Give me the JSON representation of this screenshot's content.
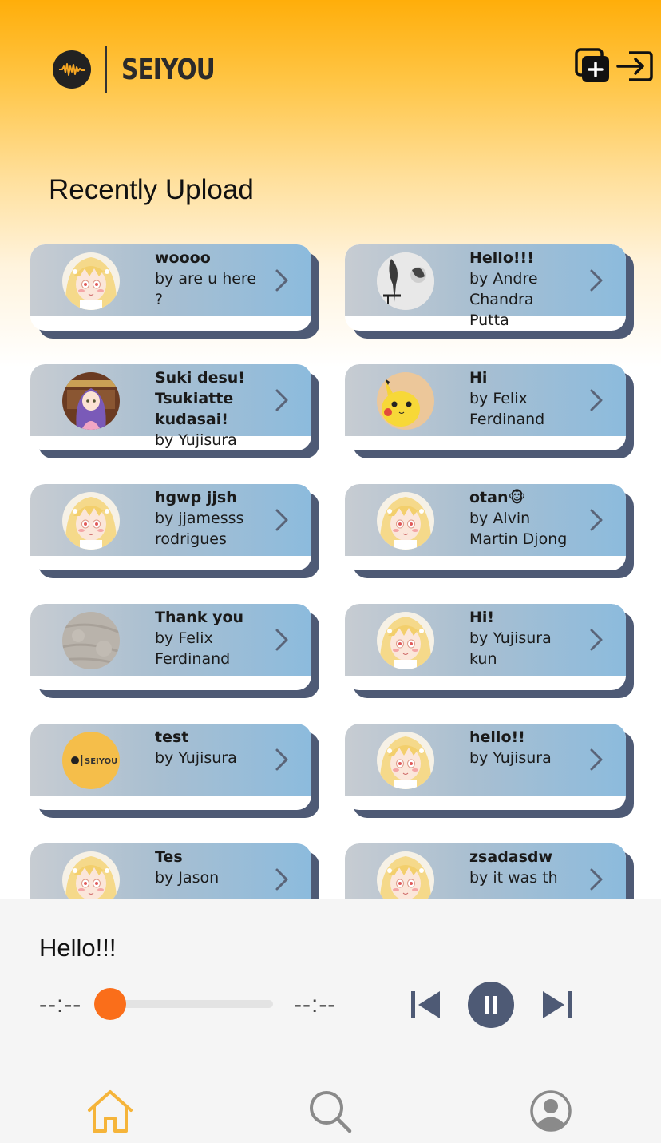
{
  "header": {
    "logo_text": "SEIYOU",
    "add_playlist_icon": "add-to-library-icon",
    "upload_icon": "import-arrow-icon"
  },
  "section": {
    "title": "Recently Upload"
  },
  "cards": [
    {
      "title": "woooo",
      "byline": "by are u here ?",
      "avatar": "anime-girl"
    },
    {
      "title": "Hello!!!",
      "byline": "by Andre Chandra Putta",
      "avatar": "bw-photo"
    },
    {
      "title": "Suki desu! Tsukiatte kudasai!",
      "byline": "by Yujisura",
      "avatar": "purple-hair-girl"
    },
    {
      "title": "Hi",
      "byline": "by Felix Ferdinand",
      "avatar": "pikachu"
    },
    {
      "title": "hgwp jjsh",
      "byline": "by jjamesss rodrigues",
      "avatar": "anime-girl"
    },
    {
      "title": "otan🐵",
      "byline": "by Alvin Martin Djong",
      "avatar": "anime-girl"
    },
    {
      "title": "Thank you",
      "byline": "by Felix Ferdinand",
      "avatar": "texture"
    },
    {
      "title": "Hi!",
      "byline": "by Yujisura kun",
      "avatar": "anime-girl"
    },
    {
      "title": "test",
      "byline": "by Yujisura",
      "avatar": "seiyou-logo"
    },
    {
      "title": "hello!!",
      "byline": "by Yujisura",
      "avatar": "anime-girl"
    },
    {
      "title": "Tes",
      "byline": "by Jason",
      "avatar": "anime-girl"
    },
    {
      "title": "zsadasdw",
      "byline": "by it was th",
      "avatar": "anime-girl"
    }
  ],
  "player": {
    "now_playing": "Hello!!!",
    "elapsed": "--:--",
    "duration": "--:--",
    "progress": 0
  },
  "tabs": [
    {
      "name": "home",
      "icon": "home-icon",
      "active": true
    },
    {
      "name": "search",
      "icon": "search-icon",
      "active": false
    },
    {
      "name": "profile",
      "icon": "user-circle-icon",
      "active": false
    }
  ],
  "colors": {
    "accent": "#ffae0a",
    "active_tab": "#f5b43a",
    "slider_thumb": "#fa6e1a",
    "control_dark": "#4e5a75",
    "card_shadow": "#4e5a75"
  }
}
